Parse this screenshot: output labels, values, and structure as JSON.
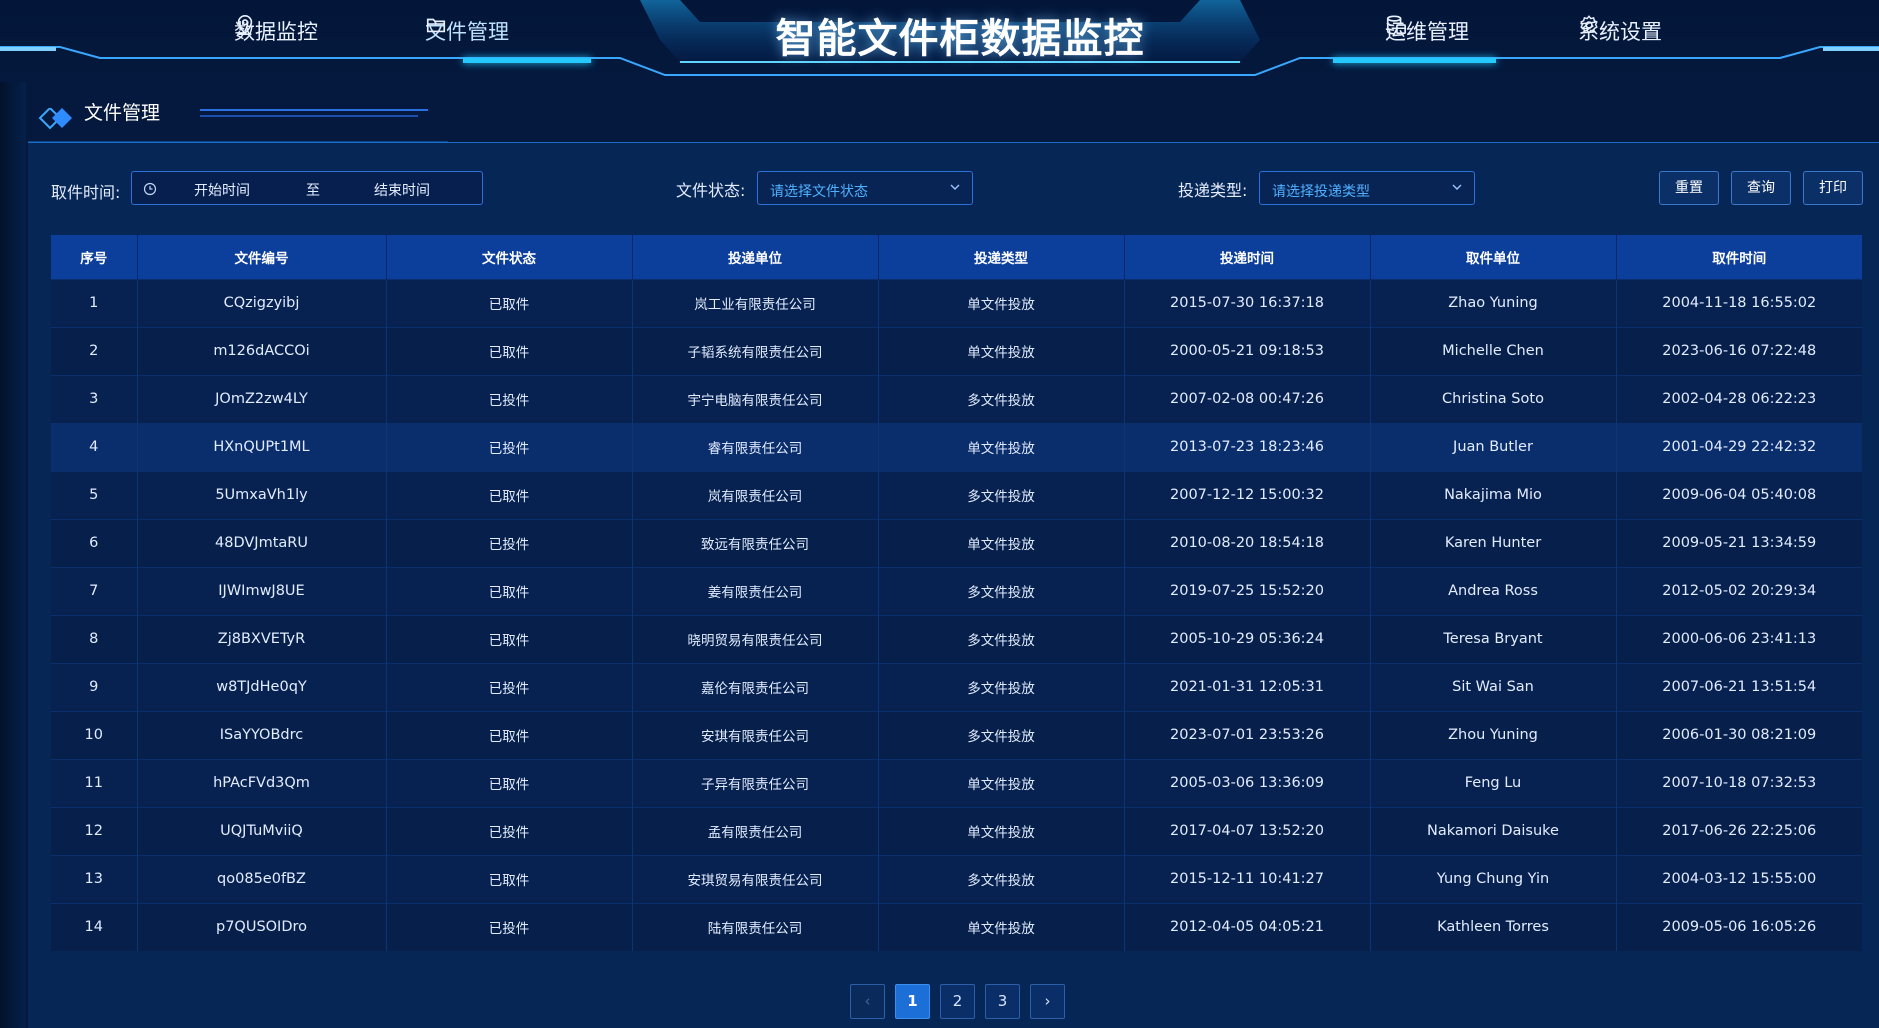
{
  "header": {
    "title": "智能文件柜数据监控",
    "nav_left": [
      {
        "label": "数据监控",
        "icon": "location-pin-icon"
      },
      {
        "label": "文件管理",
        "icon": "folder-icon",
        "active": true
      }
    ],
    "nav_right": [
      {
        "label": "运维管理",
        "icon": "database-icon"
      },
      {
        "label": "系统设置",
        "icon": "gear-icon"
      }
    ]
  },
  "section": {
    "title": "文件管理"
  },
  "filters": {
    "pickup_time_label": "取件时间:",
    "start_placeholder": "开始时间",
    "range_separator": "至",
    "end_placeholder": "结束时间",
    "status_label": "文件状态:",
    "status_placeholder": "请选择文件状态",
    "delivery_type_label": "投递类型:",
    "delivery_type_placeholder": "请选择投递类型",
    "reset_label": "重置",
    "query_label": "查询",
    "print_label": "打印"
  },
  "table": {
    "headers": [
      "序号",
      "文件编号",
      "文件状态",
      "投递单位",
      "投递类型",
      "投递时间",
      "取件单位",
      "取件时间"
    ],
    "rows": [
      [
        "1",
        "CQzigzyibj",
        "已取件",
        "岚工业有限责任公司",
        "单文件投放",
        "2015-07-30 16:37:18",
        "Zhao Yuning",
        "2004-11-18 16:55:02"
      ],
      [
        "2",
        "m126dACCOi",
        "已取件",
        "子韬系统有限责任公司",
        "单文件投放",
        "2000-05-21 09:18:53",
        "Michelle Chen",
        "2023-06-16 07:22:48"
      ],
      [
        "3",
        "JOmZ2zw4LY",
        "已投件",
        "宇宁电脑有限责任公司",
        "多文件投放",
        "2007-02-08 00:47:26",
        "Christina Soto",
        "2002-04-28 06:22:23"
      ],
      [
        "4",
        "HXnQUPt1ML",
        "已投件",
        "睿有限责任公司",
        "单文件投放",
        "2013-07-23 18:23:46",
        "Juan Butler",
        "2001-04-29 22:42:32"
      ],
      [
        "5",
        "5UmxaVh1ly",
        "已取件",
        "岚有限责任公司",
        "多文件投放",
        "2007-12-12 15:00:32",
        "Nakajima Mio",
        "2009-06-04 05:40:08"
      ],
      [
        "6",
        "48DVJmtaRU",
        "已投件",
        "致远有限责任公司",
        "单文件投放",
        "2010-08-20 18:54:18",
        "Karen Hunter",
        "2009-05-21 13:34:59"
      ],
      [
        "7",
        "IJWImwJ8UE",
        "已取件",
        "姜有限责任公司",
        "多文件投放",
        "2019-07-25 15:52:20",
        "Andrea Ross",
        "2012-05-02 20:29:34"
      ],
      [
        "8",
        "Zj8BXVETyR",
        "已取件",
        "晓明贸易有限责任公司",
        "多文件投放",
        "2005-10-29 05:36:24",
        "Teresa Bryant",
        "2000-06-06 23:41:13"
      ],
      [
        "9",
        "w8TJdHe0qY",
        "已投件",
        "嘉伦有限责任公司",
        "多文件投放",
        "2021-01-31 12:05:31",
        "Sit Wai San",
        "2007-06-21 13:51:54"
      ],
      [
        "10",
        "ISaYYOBdrc",
        "已取件",
        "安琪有限责任公司",
        "多文件投放",
        "2023-07-01 23:53:26",
        "Zhou Yuning",
        "2006-01-30 08:21:09"
      ],
      [
        "11",
        "hPAcFVd3Qm",
        "已取件",
        "子异有限责任公司",
        "单文件投放",
        "2005-03-06 13:36:09",
        "Feng Lu",
        "2007-10-18 07:32:53"
      ],
      [
        "12",
        "UQJTuMviiQ",
        "已投件",
        "孟有限责任公司",
        "单文件投放",
        "2017-04-07 13:52:20",
        "Nakamori Daisuke",
        "2017-06-26 22:25:06"
      ],
      [
        "13",
        "qo085e0fBZ",
        "已取件",
        "安琪贸易有限责任公司",
        "多文件投放",
        "2015-12-11 10:41:27",
        "Yung Chung Yin",
        "2004-03-12 15:55:00"
      ],
      [
        "14",
        "p7QUSOIDro",
        "已投件",
        "陆有限责任公司",
        "单文件投放",
        "2012-04-05 04:05:21",
        "Kathleen Torres",
        "2009-05-06 16:05:26"
      ]
    ]
  },
  "pagination": {
    "prev": "‹",
    "pages": [
      "1",
      "2",
      "3"
    ],
    "current": "1",
    "next": "›"
  },
  "colors": {
    "background": "#04193d",
    "accent": "#25c9ff",
    "table_header": "#0c3f9c"
  }
}
